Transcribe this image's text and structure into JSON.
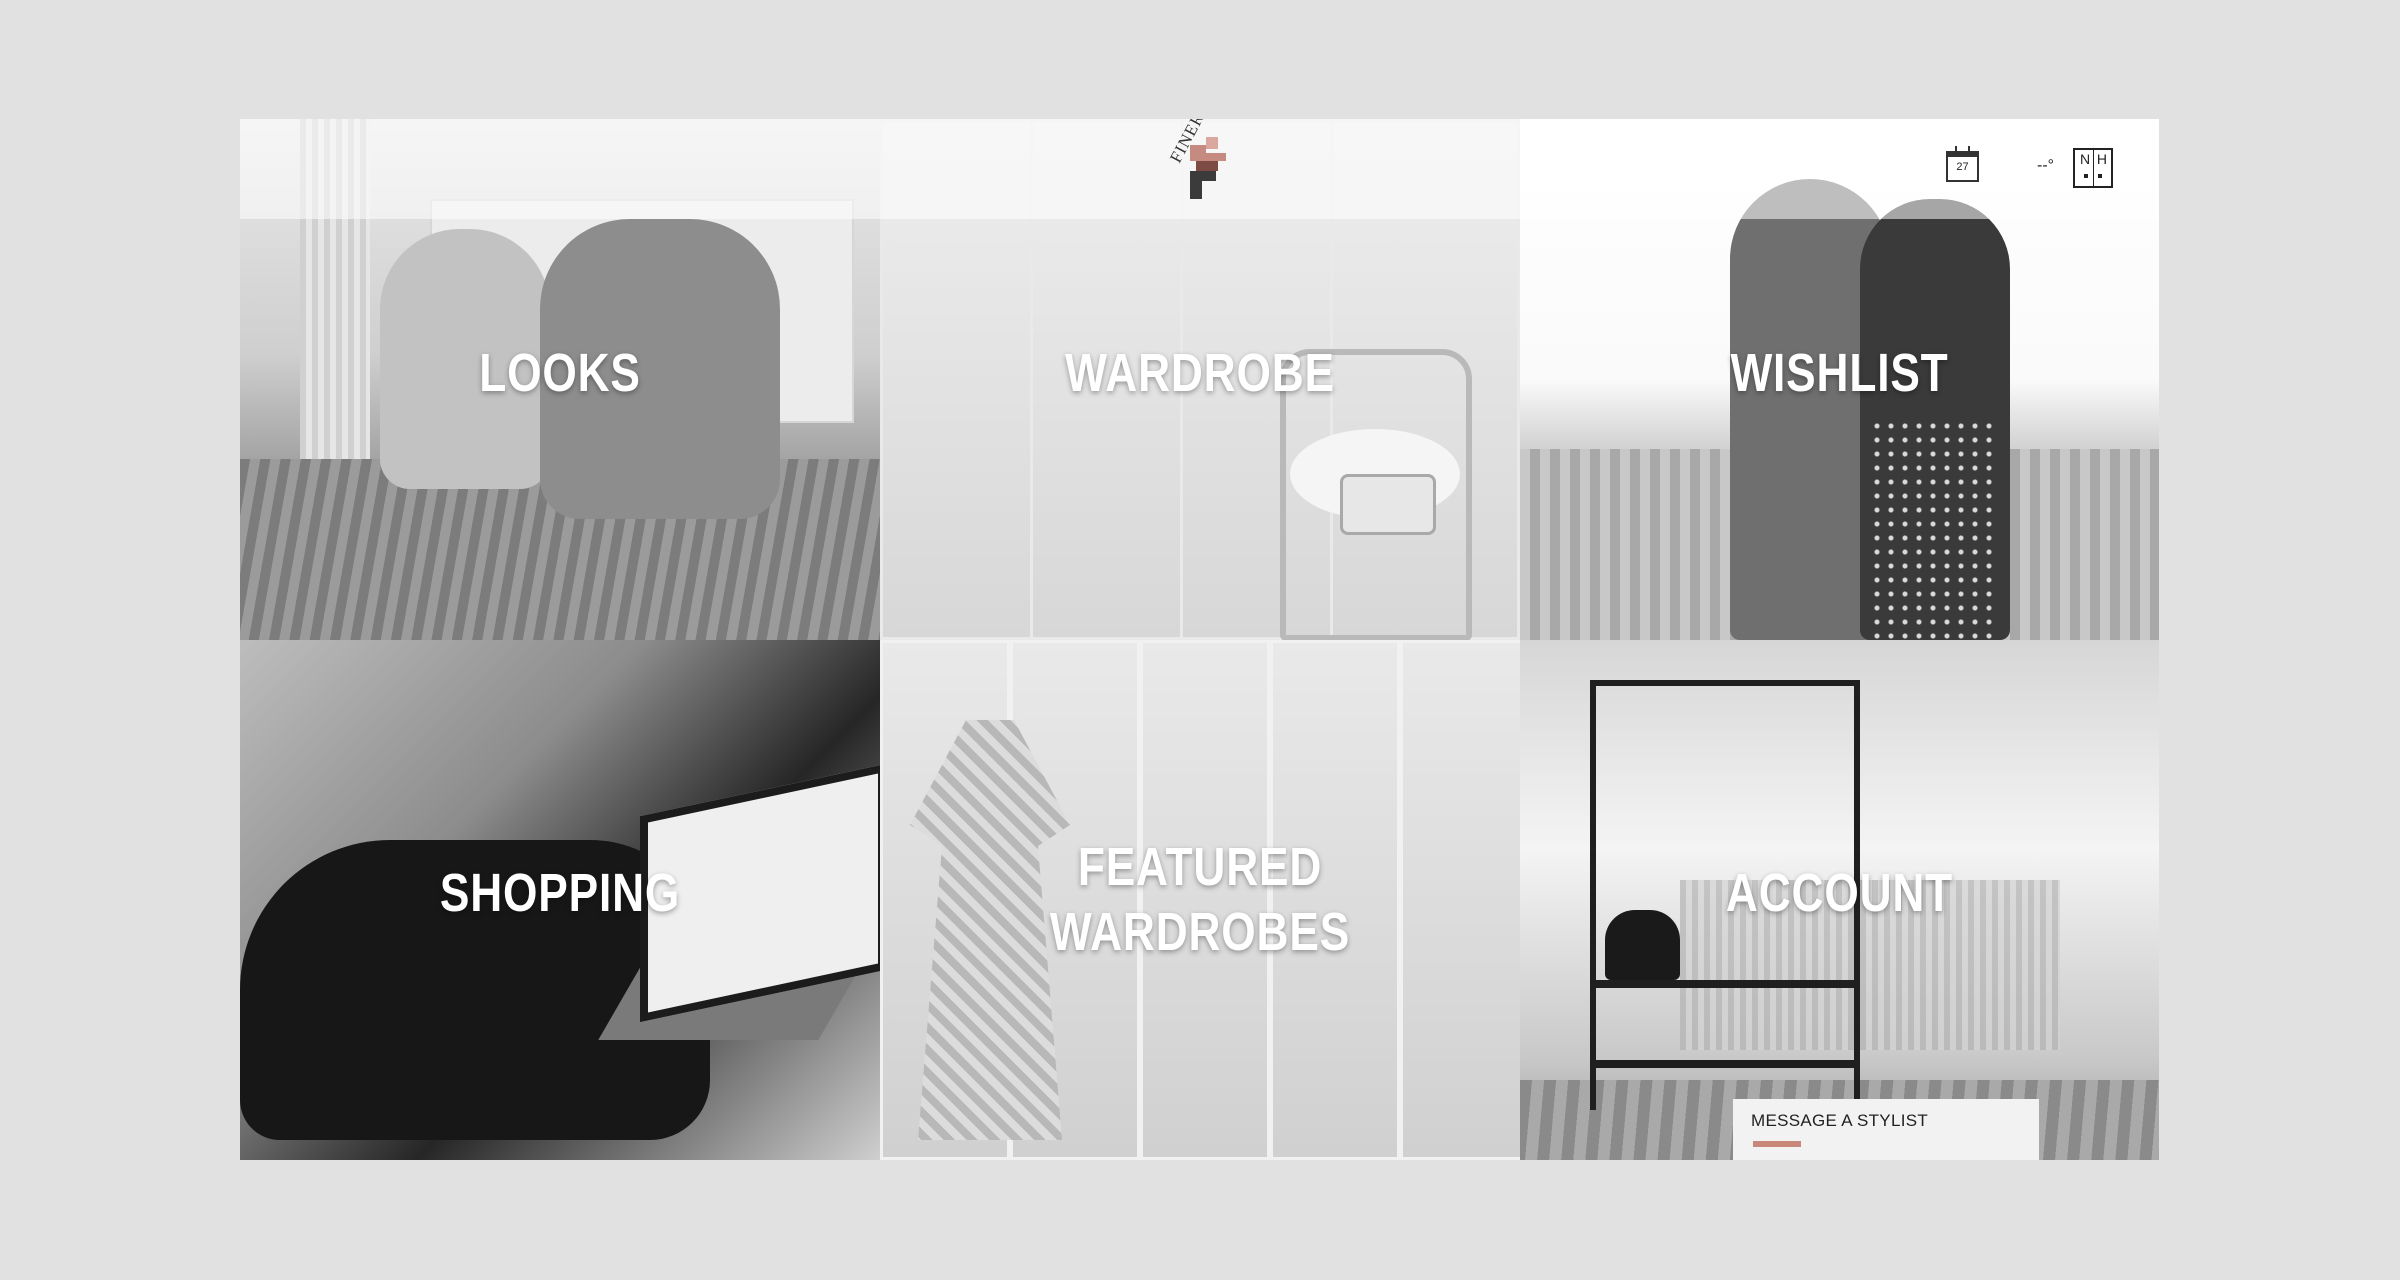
{
  "header": {
    "logo_text": "FINERY",
    "calendar_day": "27",
    "temperature": "--°",
    "nh_n": "N",
    "nh_h": "H"
  },
  "tiles": [
    {
      "label_lines": [
        "LOOKS"
      ]
    },
    {
      "label_lines": [
        "WARDROBE"
      ]
    },
    {
      "label_lines": [
        "WISHLIST"
      ]
    },
    {
      "label_lines": [
        "SHOPPING"
      ]
    },
    {
      "label_lines": [
        "FEATURED",
        "WARDROBES"
      ]
    },
    {
      "label_lines": [
        "ACCOUNT"
      ]
    }
  ],
  "stylist": {
    "label": "MESSAGE A STYLIST"
  },
  "colors": {
    "accent": "#c9877a",
    "page_background": "#e1e1e1",
    "logo_dark": "#3b3b3b",
    "logo_rose": "#c58a80"
  }
}
